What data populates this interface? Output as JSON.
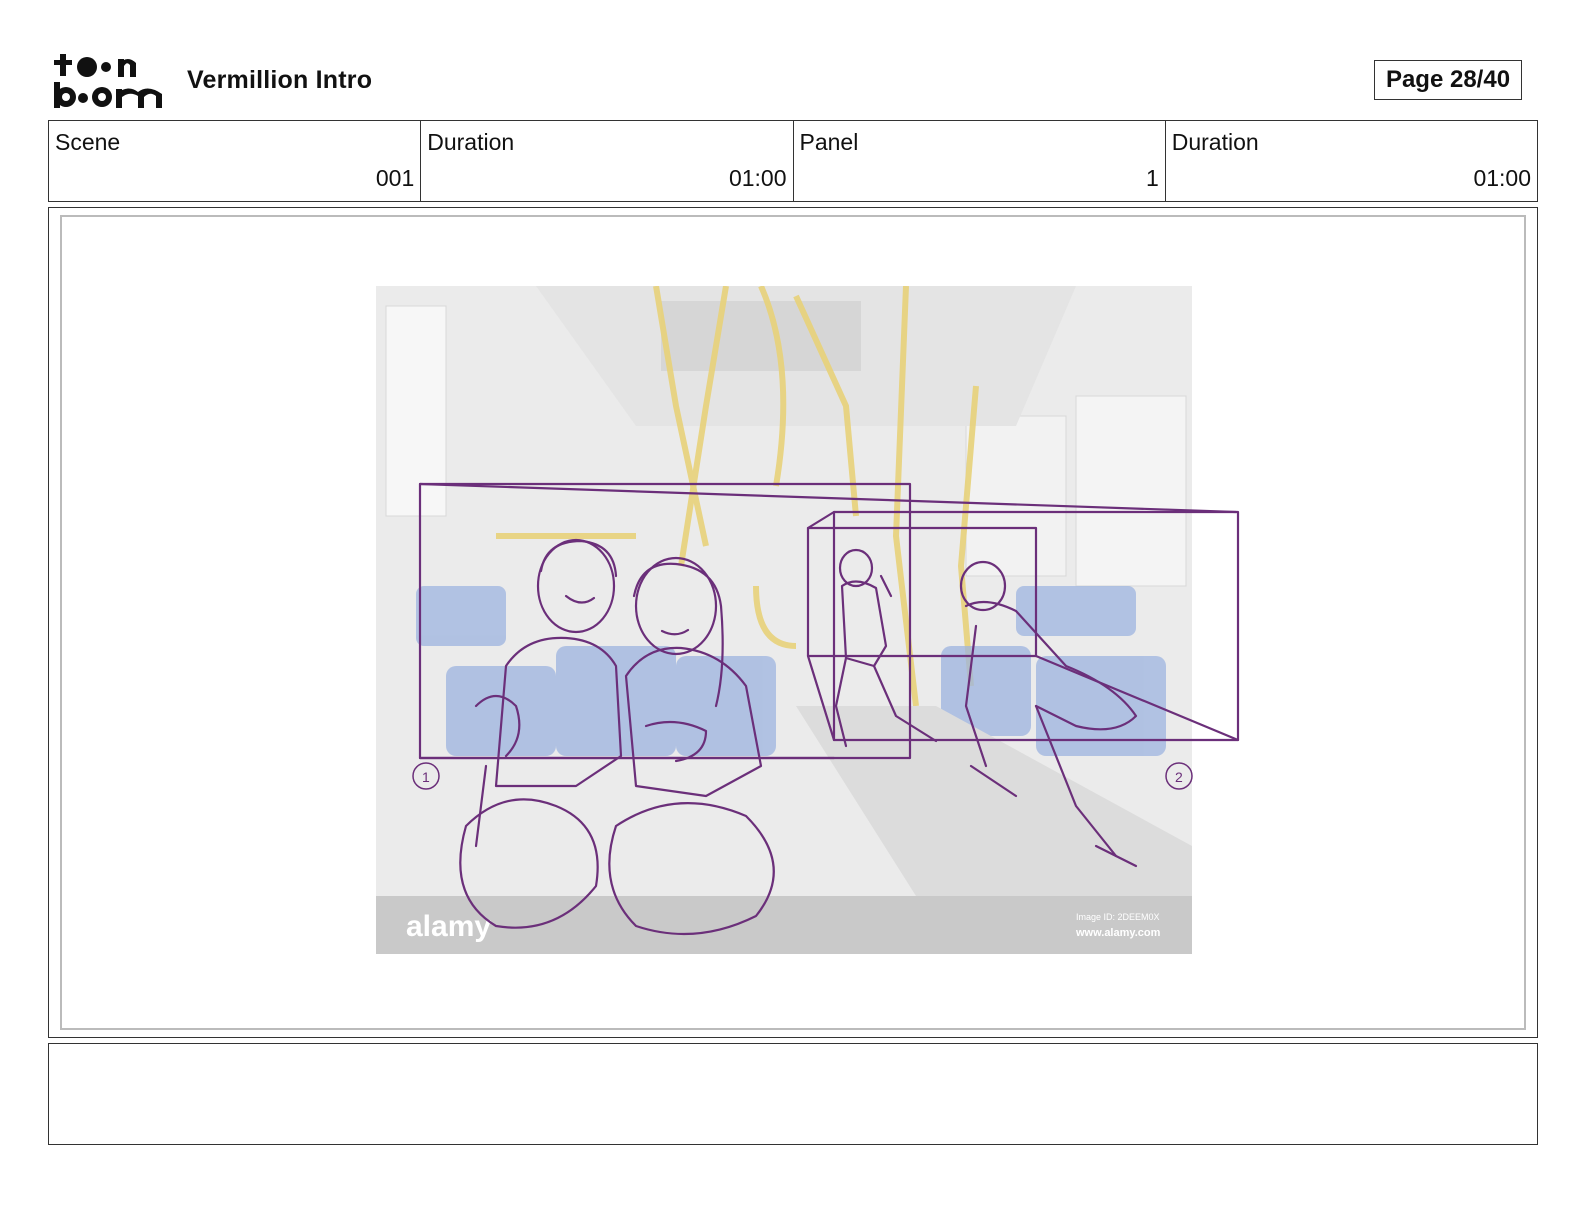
{
  "header": {
    "logo_text": "toon boom",
    "project_title": "Vermillion Intro",
    "page": "Page 28/40"
  },
  "info": {
    "scene_label": "Scene",
    "scene_value": "001",
    "scene_duration_label": "Duration",
    "scene_duration_value": "01:00",
    "panel_label": "Panel",
    "panel_value": "1",
    "panel_duration_label": "Duration",
    "panel_duration_value": "01:00"
  },
  "panel": {
    "watermark_logo": "alamy",
    "watermark_id": "Image ID: 2DEEM0X",
    "watermark_url": "www.alamy.com",
    "marker_1": "1",
    "marker_2": "2",
    "sketch_color": "#6b2f7a",
    "pole_color": "#e8d27a",
    "seat_color": "#9db4e0"
  },
  "notes": {
    "text": ""
  }
}
